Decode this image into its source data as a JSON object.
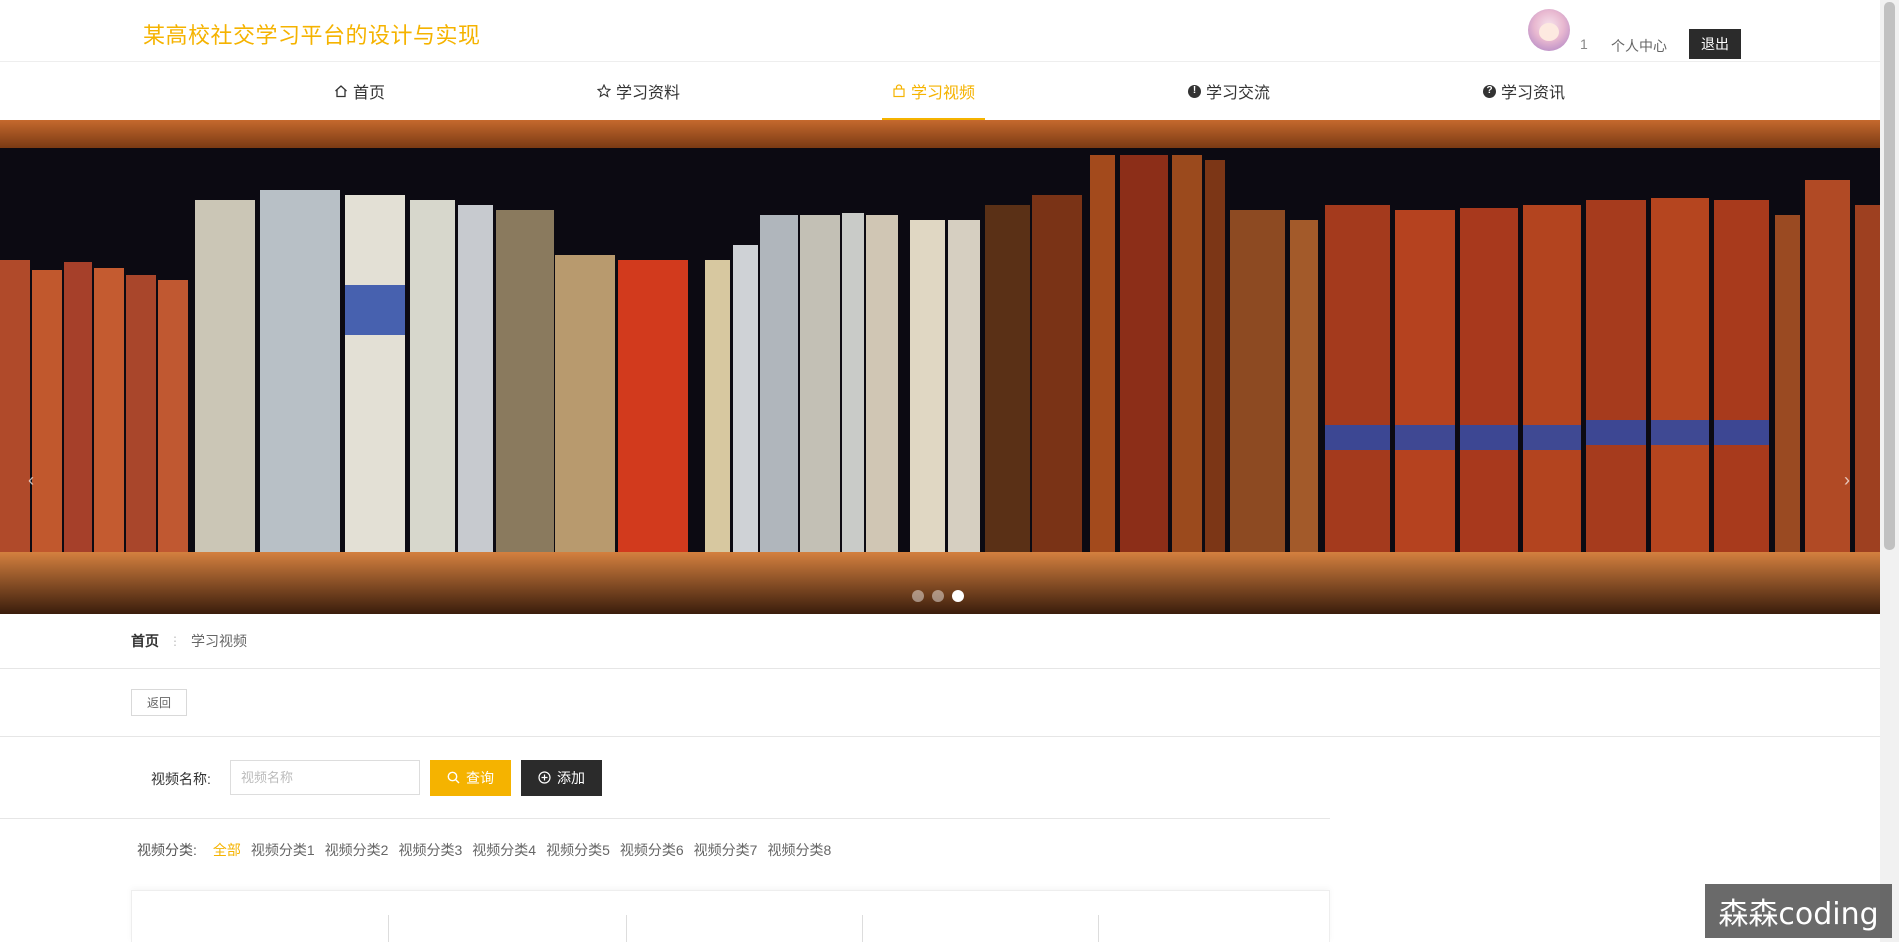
{
  "header": {
    "site_title": "某高校社交学习平台的设计与实现",
    "username": "1",
    "user_center": "个人中心",
    "logout": "退出"
  },
  "nav": {
    "items": [
      {
        "label": "首页",
        "icon": "home-icon"
      },
      {
        "label": "学习资料",
        "icon": "star-icon"
      },
      {
        "label": "学习视频",
        "icon": "bag-icon"
      },
      {
        "label": "学习交流",
        "icon": "alert-circle-icon"
      },
      {
        "label": "学习资讯",
        "icon": "question-circle-icon"
      }
    ],
    "active_index": 2
  },
  "banner": {
    "slide_count": 3,
    "active_slide": 3
  },
  "breadcrumb": {
    "home": "首页",
    "separator": "⋮",
    "current": "学习视频"
  },
  "back_button": "返回",
  "search": {
    "label": "视频名称:",
    "placeholder": "视频名称",
    "value": "",
    "query_label": "查询",
    "add_label": "添加"
  },
  "categories": {
    "label": "视频分类:",
    "items": [
      "全部",
      "视频分类1",
      "视频分类2",
      "视频分类3",
      "视频分类4",
      "视频分类5",
      "视频分类6",
      "视频分类7",
      "视频分类8"
    ],
    "active_index": 0
  },
  "watermark": "森森coding",
  "colors": {
    "accent": "#f5b300",
    "dark_button": "#2b2b2b"
  }
}
